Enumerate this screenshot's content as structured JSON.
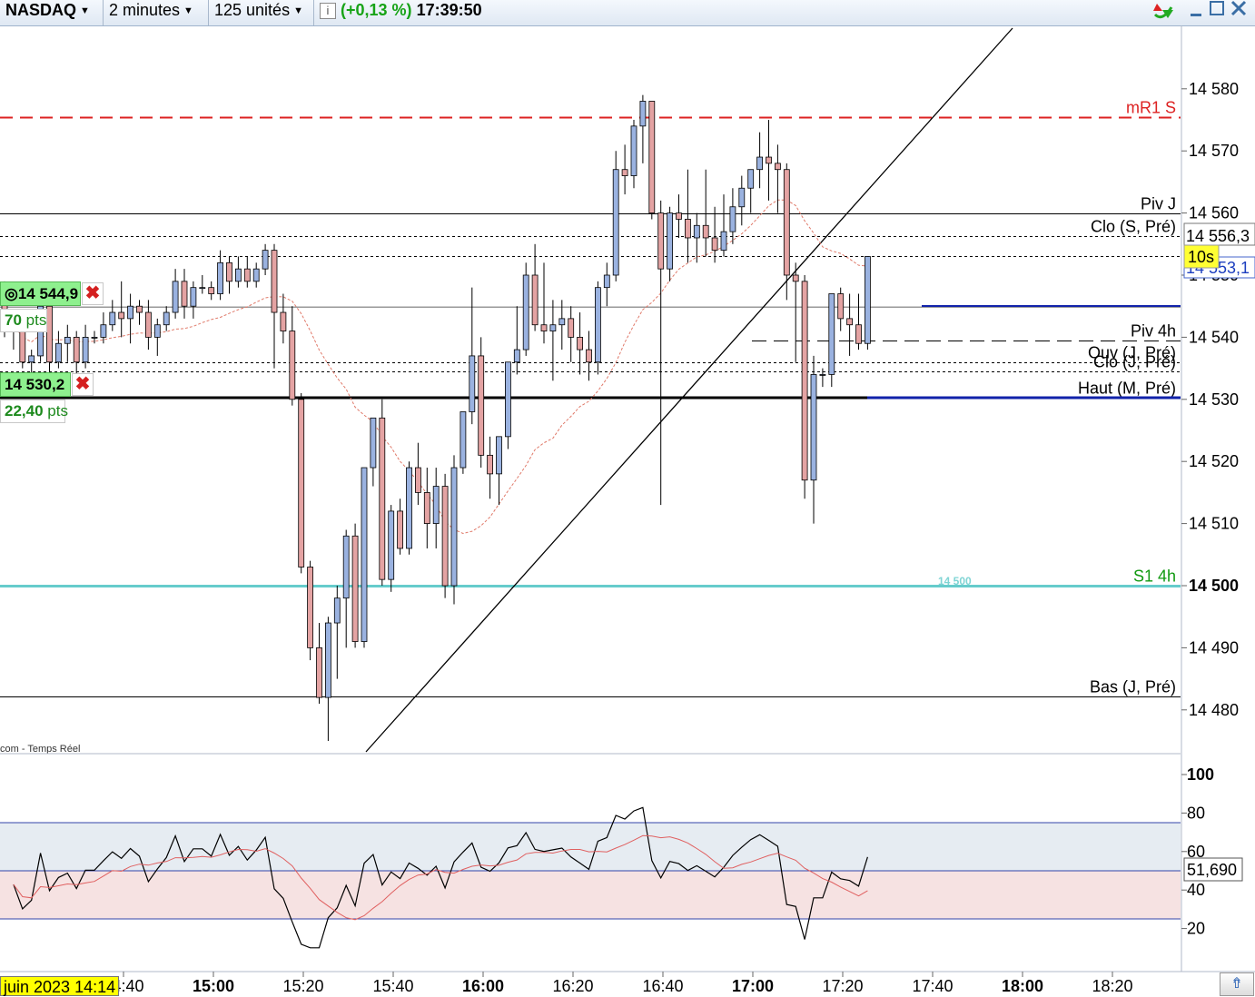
{
  "toolbar": {
    "instrument": "NASDAQ",
    "timeframe": "2 minutes",
    "units": "125 unités",
    "info_icon": "i",
    "change": "(+0,13 %)",
    "time": "17:39:50"
  },
  "price_axis": {
    "ticks": [
      "14 580",
      "14 570",
      "14 560",
      "14 550",
      "14 540",
      "14 530",
      "14 520",
      "14 510",
      "14 500",
      "14 490",
      "14 480"
    ],
    "bold_tick": "14 500",
    "last_price": "14 553,1",
    "clo_s_value": "14 556,3",
    "timer": "10s"
  },
  "levels": [
    {
      "name": "mR1 S",
      "price": 14575.5,
      "style": "dashed",
      "color": "#dd2222"
    },
    {
      "name": "Piv J",
      "price": 14560,
      "style": "solid",
      "color": "#000000"
    },
    {
      "name": "Clo (S, Pré)",
      "price": 14556.3,
      "style": "dotted",
      "color": "#000000"
    },
    {
      "name": "",
      "price": 14553.1,
      "style": "dotted",
      "color": "#000000"
    },
    {
      "name": "",
      "price": 14544.9,
      "style": "solid-light",
      "color": "#888888"
    },
    {
      "name": "Piv 4h",
      "price": 14539.5,
      "style": "dashed-long",
      "color": "#000000"
    },
    {
      "name": "Ouv (J, Pré)",
      "price": 14536,
      "style": "dotted",
      "color": "#000000"
    },
    {
      "name": "Clo (J, Pré)",
      "price": 14534.5,
      "style": "dotted",
      "color": "#000000"
    },
    {
      "name": "Haut (M, Pré)",
      "price": 14530.2,
      "style": "thick",
      "color": "#000000"
    },
    {
      "name": "S1 4h",
      "price": 14500,
      "style": "solid",
      "color": "#66cccc"
    },
    {
      "name": "Bas (J, Pré)",
      "price": 14482.2,
      "style": "solid",
      "color": "#000000"
    }
  ],
  "s1_inline_label": "14 500",
  "source_label": "com - Temps Réel",
  "orders": [
    {
      "price": "14 544,9",
      "pts": "70",
      "pts_unit": "pts"
    },
    {
      "price": "14 530,2",
      "pts": "22,40",
      "pts_unit": "pts"
    }
  ],
  "oscillator": {
    "ticks": [
      "100",
      "80",
      "60",
      "40",
      "20"
    ],
    "value": "51,690",
    "upper_band": 75,
    "middle": 50,
    "lower_band": 25
  },
  "time_axis": {
    "labels": [
      {
        "text": "14:40",
        "bold": false
      },
      {
        "text": "15:00",
        "bold": true
      },
      {
        "text": "15:20",
        "bold": false
      },
      {
        "text": "15:40",
        "bold": false
      },
      {
        "text": "16:00",
        "bold": true
      },
      {
        "text": "16:20",
        "bold": false
      },
      {
        "text": "16:40",
        "bold": false
      },
      {
        "text": "17:00",
        "bold": true
      },
      {
        "text": "17:20",
        "bold": false
      },
      {
        "text": "17:40",
        "bold": false
      },
      {
        "text": "18:00",
        "bold": true
      },
      {
        "text": "18:20",
        "bold": false
      }
    ],
    "date_label": "juin 2023 14:14"
  },
  "colors": {
    "bull": "#9ab2e0",
    "bear": "#e4a3a3",
    "mR1": "#dd2222",
    "s1": "#66cccc",
    "price_line": "#1122aa"
  },
  "chart_data": {
    "type": "candlestick",
    "y_range": [
      14471,
      14591
    ],
    "candles": [
      [
        14548,
        14549,
        14540,
        14543
      ],
      [
        14543,
        14544,
        14538,
        14541
      ],
      [
        14541,
        14542,
        14535,
        14536
      ],
      [
        14536,
        14538,
        14533,
        14537
      ],
      [
        14537,
        14548,
        14536,
        14545
      ],
      [
        14545,
        14547,
        14534,
        14536
      ],
      [
        14536,
        14541,
        14535,
        14539
      ],
      [
        14539,
        14542,
        14536,
        14540
      ],
      [
        14540,
        14541,
        14534,
        14536
      ],
      [
        14536,
        14542,
        14535,
        14540
      ],
      [
        14540,
        14541,
        14539,
        14540
      ],
      [
        14540,
        14544,
        14539,
        14542
      ],
      [
        14542,
        14546,
        14541,
        14544
      ],
      [
        14544,
        14549,
        14540,
        14543
      ],
      [
        14543,
        14547,
        14539,
        14545
      ],
      [
        14545,
        14546,
        14542,
        14544
      ],
      [
        14544,
        14546,
        14538,
        14540
      ],
      [
        14540,
        14543,
        14537,
        14542
      ],
      [
        14542,
        14545,
        14541,
        14544
      ],
      [
        14544,
        14551,
        14543,
        14549
      ],
      [
        14549,
        14551,
        14543,
        14545
      ],
      [
        14545,
        14549,
        14543,
        14548
      ],
      [
        14548,
        14550,
        14547,
        14548
      ],
      [
        14548,
        14549,
        14546,
        14547
      ],
      [
        14547,
        14554,
        14546,
        14552
      ],
      [
        14552,
        14553,
        14547,
        14549
      ],
      [
        14549,
        14553,
        14548,
        14551
      ],
      [
        14551,
        14553,
        14548,
        14549
      ],
      [
        14549,
        14552,
        14548,
        14551
      ],
      [
        14551,
        14555,
        14550,
        14554
      ],
      [
        14554,
        14555,
        14535,
        14544
      ],
      [
        14544,
        14547,
        14539,
        14541
      ],
      [
        14541,
        14545,
        14529,
        14530
      ],
      [
        14530,
        14531,
        14502,
        14503
      ],
      [
        14503,
        14504,
        14488,
        14490
      ],
      [
        14490,
        14494,
        14481,
        14482
      ],
      [
        14482,
        14495,
        14475,
        14494
      ],
      [
        14494,
        14500,
        14485,
        14498
      ],
      [
        14498,
        14509,
        14490,
        14508
      ],
      [
        14508,
        14510,
        14490,
        14491
      ],
      [
        14491,
        14511,
        14490,
        14519
      ],
      [
        14519,
        14527,
        14516,
        14527
      ],
      [
        14527,
        14530,
        14500,
        14501
      ],
      [
        14501,
        14513,
        14499,
        14512
      ],
      [
        14512,
        14514,
        14505,
        14506
      ],
      [
        14506,
        14520,
        14505,
        14519
      ],
      [
        14519,
        14523,
        14513,
        14515
      ],
      [
        14515,
        14519,
        14506,
        14510
      ],
      [
        14510,
        14519,
        14506,
        14516
      ],
      [
        14516,
        14518,
        14498,
        14500
      ],
      [
        14500,
        14521,
        14497,
        14519
      ],
      [
        14519,
        14525,
        14518,
        14528
      ],
      [
        14528,
        14548,
        14526,
        14537
      ],
      [
        14537,
        14540,
        14519,
        14521
      ],
      [
        14521,
        14524,
        14514,
        14518
      ],
      [
        14518,
        14523,
        14513,
        14524
      ],
      [
        14524,
        14534,
        14522,
        14536
      ],
      [
        14536,
        14545,
        14534,
        14538
      ],
      [
        14538,
        14552,
        14537,
        14550
      ],
      [
        14550,
        14555,
        14541,
        14542
      ],
      [
        14542,
        14552,
        14539,
        14541
      ],
      [
        14541,
        14546,
        14533,
        14542
      ],
      [
        14542,
        14546,
        14538,
        14543
      ],
      [
        14543,
        14545,
        14536,
        14540
      ],
      [
        14540,
        14544,
        14534,
        14538
      ],
      [
        14538,
        14541,
        14533,
        14536
      ],
      [
        14536,
        14549,
        14534,
        14548
      ],
      [
        14548,
        14552,
        14545,
        14550
      ],
      [
        14550,
        14570,
        14549,
        14567
      ],
      [
        14567,
        14571,
        14563,
        14566
      ],
      [
        14566,
        14575,
        14564,
        14574
      ],
      [
        14574,
        14579,
        14568,
        14578
      ],
      [
        14578,
        14578,
        14559,
        14560
      ],
      [
        14560,
        14562,
        14513,
        14551
      ],
      [
        14551,
        14561,
        14549,
        14560
      ],
      [
        14560,
        14563,
        14556,
        14559
      ],
      [
        14559,
        14567,
        14552,
        14556
      ],
      [
        14556,
        14560,
        14552,
        14558
      ],
      [
        14558,
        14567,
        14553,
        14556
      ],
      [
        14556,
        14561,
        14552,
        14554
      ],
      [
        14554,
        14563,
        14553,
        14557
      ],
      [
        14557,
        14564,
        14555,
        14561
      ],
      [
        14561,
        14566,
        14558,
        14564
      ],
      [
        14564,
        14567,
        14560,
        14567
      ],
      [
        14567,
        14573,
        14564,
        14569
      ],
      [
        14569,
        14575,
        14562,
        14568
      ],
      [
        14568,
        14571,
        14560,
        14567
      ],
      [
        14567,
        14568,
        14546,
        14550
      ],
      [
        14550,
        14552,
        14536,
        14549
      ],
      [
        14549,
        14550,
        14514,
        14517
      ],
      [
        14517,
        14537,
        14510,
        14534
      ],
      [
        14534,
        14535,
        14532,
        14534
      ],
      [
        14534,
        14539,
        14532,
        14547
      ],
      [
        14547,
        14548,
        14541,
        14543
      ],
      [
        14543,
        14547,
        14537,
        14542
      ],
      [
        14542,
        14547,
        14538,
        14539
      ],
      [
        14539,
        14553,
        14538,
        14553
      ]
    ]
  }
}
